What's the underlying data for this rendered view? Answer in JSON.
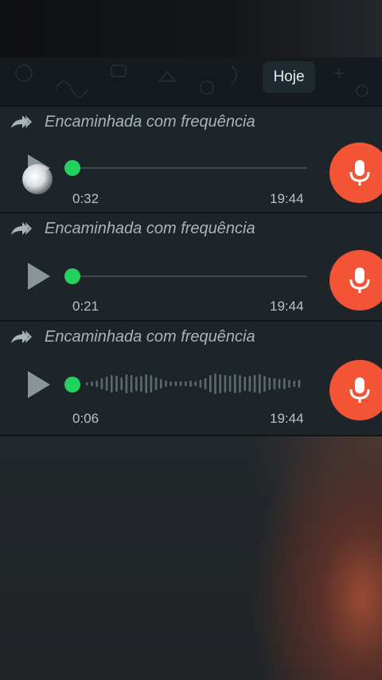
{
  "date_pill": "Hoje",
  "colors": {
    "accent_green": "#22d15f",
    "mic_orange": "#f25435",
    "bubble": "#1d2528"
  },
  "messages": [
    {
      "forwarded_label": "Encaminhada com frequência",
      "duration": "0:32",
      "time": "19:44",
      "has_waveform": false,
      "progress": 0
    },
    {
      "forwarded_label": "Encaminhada com frequência",
      "duration": "0:21",
      "time": "19:44",
      "has_waveform": false,
      "progress": 0
    },
    {
      "forwarded_label": "Encaminhada com frequência",
      "duration": "0:06",
      "time": "19:44",
      "has_waveform": true,
      "progress": 0
    }
  ],
  "icons": {
    "forward": "double-forward-arrow-icon",
    "play": "play-icon",
    "mic": "microphone-icon"
  }
}
